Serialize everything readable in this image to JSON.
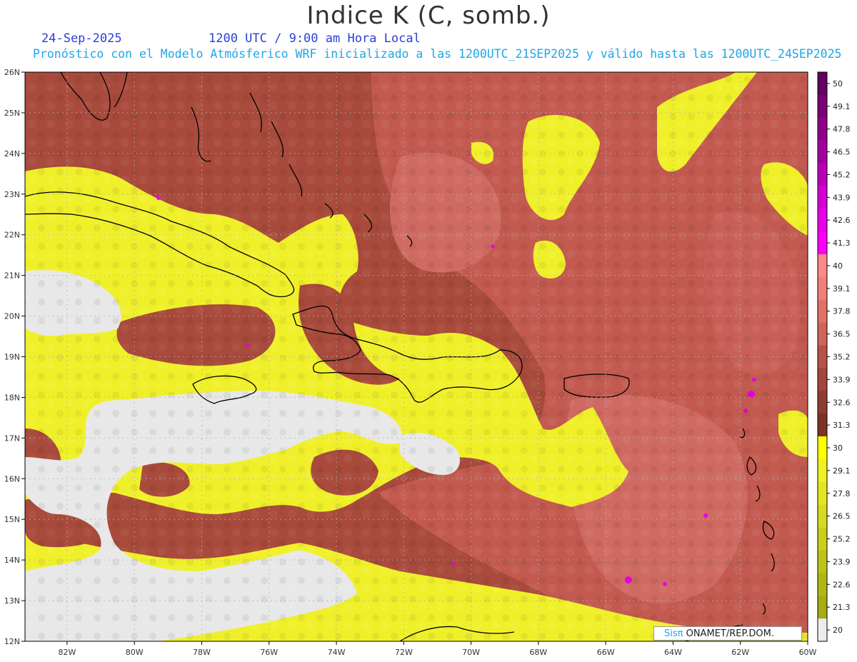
{
  "header": {
    "title": "Indice K (C, somb.)",
    "date": "24-Sep-2025",
    "time": "1200 UTC / 9:00 am Hora Local",
    "info": "Pronóstico con el Modelo Atmósferico WRF inicializado a las 1200UTC_21SEP2025 y válido hasta las  1200UTC_24SEP2025"
  },
  "map": {
    "lon_labels": [
      "82W",
      "80W",
      "78W",
      "76W",
      "74W",
      "72W",
      "70W",
      "68W",
      "66W",
      "64W",
      "62W",
      "60W"
    ],
    "lat_labels": [
      "26N",
      "25N",
      "24N",
      "23N",
      "22N",
      "21N",
      "20N",
      "19N",
      "18N",
      "17N",
      "16N",
      "15N",
      "14N",
      "13N",
      "12N"
    ],
    "lon_range": [
      -83.25,
      -60
    ],
    "lat_range": [
      12,
      26
    ],
    "colors": {
      "background_dry": "#e8e8e8",
      "low_yellow": "#f2f23a",
      "mid_red": "#a84a3c",
      "high_red": "#cd6660",
      "coastline": "#000000"
    }
  },
  "colorbar": {
    "labels": [
      "50",
      "49.1",
      "47.8",
      "46.5",
      "45.2",
      "43.9",
      "42.6",
      "41.3",
      "40",
      "39.1",
      "37.8",
      "36.5",
      "35.2",
      "33.9",
      "32.6",
      "31.3",
      "30",
      "29.1",
      "27.8",
      "26.5",
      "25.2",
      "23.9",
      "22.6",
      "21.3",
      "20"
    ],
    "colors": [
      "#650060",
      "#780073",
      "#8e0089",
      "#a300a0",
      "#bb00b8",
      "#d400d2",
      "#e800e6",
      "#fb00fb",
      "#fc8888",
      "#ee8078",
      "#e07268",
      "#d06458",
      "#b85248",
      "#a3463c",
      "#8e3c32",
      "#7e3226",
      "#ffff00",
      "#f0f024",
      "#e4e624",
      "#d7da20",
      "#cbce1c",
      "#bec31a",
      "#b2b716",
      "#a6ac12",
      "#ececec"
    ]
  },
  "credit": {
    "prefix": "Sis",
    "symbol": "π",
    "suffix": " ONAMET/REP.DOM."
  }
}
